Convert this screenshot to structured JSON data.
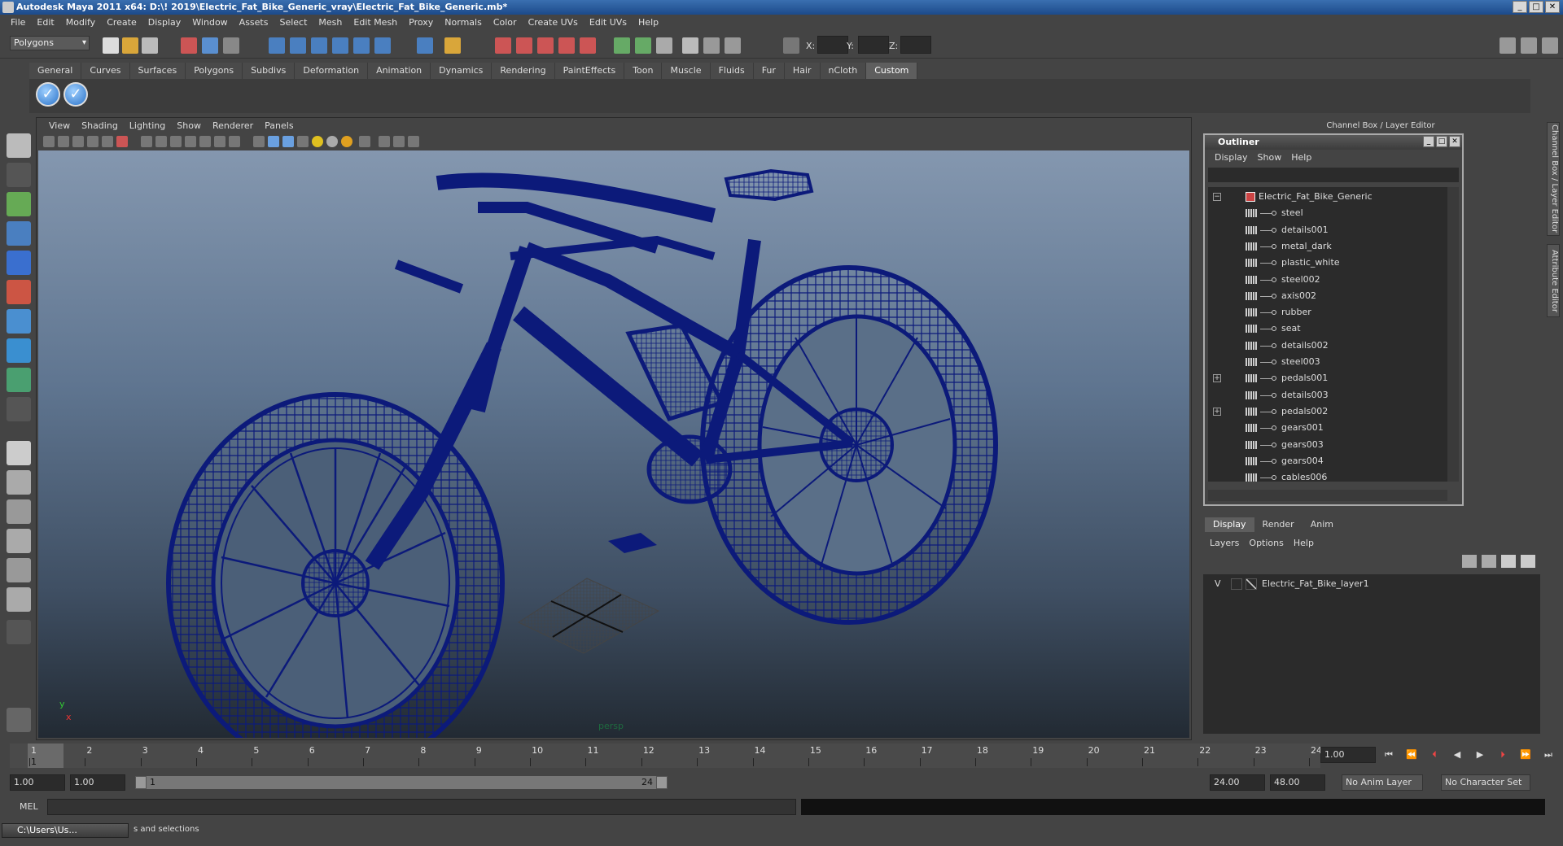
{
  "window": {
    "title": "Autodesk Maya 2011 x64: D:\\! 2019\\Electric_Fat_Bike_Generic_vray\\Electric_Fat_Bike_Generic.mb*",
    "minimize": "_",
    "maximize": "□",
    "close": "✕"
  },
  "menubar": [
    "File",
    "Edit",
    "Modify",
    "Create",
    "Display",
    "Window",
    "Assets",
    "Select",
    "Mesh",
    "Edit Mesh",
    "Proxy",
    "Normals",
    "Color",
    "Create UVs",
    "Edit UVs",
    "Help"
  ],
  "statusline": {
    "mode": "Polygons",
    "x_label": "X:",
    "y_label": "Y:",
    "z_label": "Z:"
  },
  "shelf": {
    "tabs": [
      "General",
      "Curves",
      "Surfaces",
      "Polygons",
      "Subdivs",
      "Deformation",
      "Animation",
      "Dynamics",
      "Rendering",
      "PaintEffects",
      "Toon",
      "Muscle",
      "Fluids",
      "Fur",
      "Hair",
      "nCloth",
      "Custom"
    ],
    "active_tab": "Custom",
    "button_glyph": "✓"
  },
  "panel": {
    "menu": [
      "View",
      "Shading",
      "Lighting",
      "Show",
      "Renderer",
      "Panels"
    ],
    "camera": "persp",
    "axis_y": "y",
    "axis_x": "x"
  },
  "right": {
    "channel_box_title": "Channel Box / Layer Editor",
    "vtab_channel": "Channel Box / Layer Editor",
    "vtab_attr": "Attribute Editor"
  },
  "outliner": {
    "title": "Outliner",
    "menu": [
      "Display",
      "Show",
      "Help"
    ],
    "root": "Electric_Fat_Bike_Generic",
    "items": [
      {
        "name": "steel",
        "expandable": false
      },
      {
        "name": "details001",
        "expandable": false
      },
      {
        "name": "metal_dark",
        "expandable": false
      },
      {
        "name": "plastic_white",
        "expandable": false
      },
      {
        "name": "steel002",
        "expandable": false
      },
      {
        "name": "axis002",
        "expandable": false
      },
      {
        "name": "rubber",
        "expandable": false
      },
      {
        "name": "seat",
        "expandable": false
      },
      {
        "name": "details002",
        "expandable": false
      },
      {
        "name": "steel003",
        "expandable": false
      },
      {
        "name": "pedals001",
        "expandable": true
      },
      {
        "name": "details003",
        "expandable": false
      },
      {
        "name": "pedals002",
        "expandable": true
      },
      {
        "name": "gears001",
        "expandable": false
      },
      {
        "name": "gears003",
        "expandable": false
      },
      {
        "name": "gears004",
        "expandable": false
      },
      {
        "name": "cables006",
        "expandable": false
      }
    ]
  },
  "layer_editor": {
    "tabs": [
      "Display",
      "Render",
      "Anim"
    ],
    "active_tab": "Display",
    "menu": [
      "Layers",
      "Options",
      "Help"
    ],
    "layers": [
      {
        "visible": "V",
        "name": "Electric_Fat_Bike_layer1"
      }
    ]
  },
  "timeline": {
    "ticks": [
      "1",
      "2",
      "3",
      "4",
      "5",
      "6",
      "7",
      "8",
      "9",
      "10",
      "11",
      "12",
      "13",
      "14",
      "15",
      "16",
      "17",
      "18",
      "19",
      "20",
      "21",
      "22",
      "23",
      "24"
    ],
    "current_frame": "1.00"
  },
  "range": {
    "start": "1.00",
    "playback_start": "1.00",
    "range_start_label": "1",
    "range_end_label": "24",
    "playback_end": "24.00",
    "end": "48.00",
    "anim_layer": "No Anim Layer",
    "character_set": "No Character Set"
  },
  "cmdline": {
    "label": "MEL"
  },
  "helpline": {
    "task": "C:\\Users\\Us...",
    "text": "s and selections"
  },
  "colors": {
    "wireframe": "#0c1a7a",
    "viewport_top": "#8497af",
    "viewport_bottom": "#222a33"
  }
}
